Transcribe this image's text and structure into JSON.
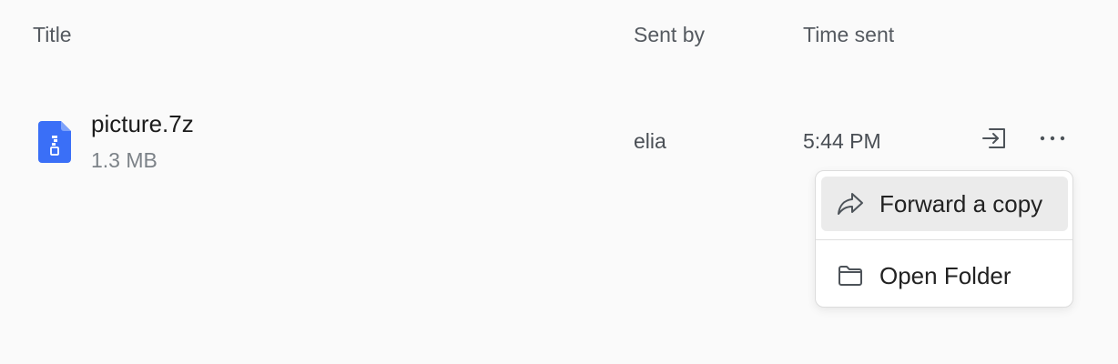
{
  "columns": {
    "title": "Title",
    "sent_by": "Sent by",
    "time_sent": "Time sent"
  },
  "file": {
    "name": "picture.7z",
    "size": "1.3 MB",
    "sender": "elia",
    "time": "5:44 PM",
    "icon": "archive-file-icon",
    "icon_color": "#3a6ff7"
  },
  "row_actions": {
    "open_icon": "open-in-icon",
    "more_icon": "more-options-icon"
  },
  "context_menu": {
    "items": [
      {
        "label": "Forward a copy",
        "icon": "forward-icon",
        "highlighted": true
      },
      {
        "label": "Open Folder",
        "icon": "folder-icon",
        "highlighted": false
      }
    ]
  }
}
